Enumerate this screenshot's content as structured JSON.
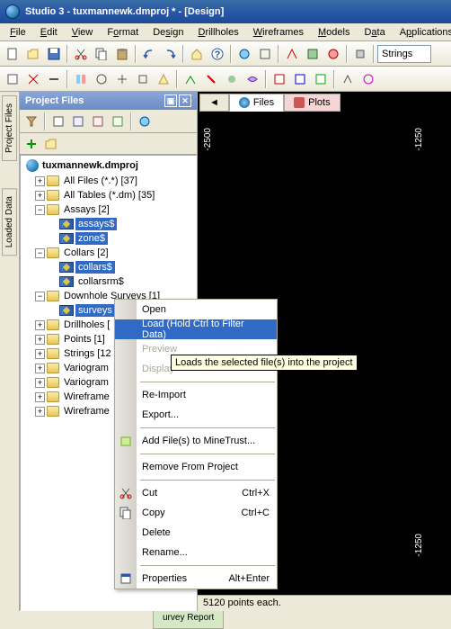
{
  "window": {
    "title": "Studio 3 - tuxmannewk.dmproj * - [Design]"
  },
  "menus": {
    "file": "File",
    "edit": "Edit",
    "view": "View",
    "format": "Format",
    "design": "Design",
    "drillholes": "Drillholes",
    "wireframes": "Wireframes",
    "models": "Models",
    "data": "Data",
    "applications": "Applications"
  },
  "toolbar2_input": {
    "value": "Strings"
  },
  "sidebar": {
    "tab1": "Project Files",
    "tab2": "Loaded Data"
  },
  "panel": {
    "title": "Project Files",
    "root": "tuxmannewk.dmproj",
    "items": {
      "all_files": "All Files (*.*) [37]",
      "all_tables": "All Tables (*.dm) [35]",
      "assays": "Assays [2]",
      "assays_item1": "assays$",
      "assays_item2": "zone$",
      "collars": "Collars [2]",
      "collars_item1": "collars$",
      "collars_item2": "collarsrm$",
      "surveys": "Downhole Surveys [1]",
      "surveys_item1": "surveys",
      "drillholes": "Drillholes [",
      "points": "Points [1]",
      "strings": "Strings [12",
      "variograms1": "Variogram",
      "variograms2": "Variogram",
      "wireframe1": "Wireframe",
      "wireframe2": "Wireframe"
    }
  },
  "viewport": {
    "tabs": {
      "files": "Files",
      "plots": "Plots"
    },
    "axis": {
      "top_left": "-2500",
      "top_right": "-1250",
      "bot_right": "-1250"
    }
  },
  "context_menu": {
    "open": "Open",
    "load": "Load  (Hold Ctrl to Filter Data)",
    "preview": "Preview",
    "display": "Display",
    "reimport": "Re-Import",
    "export": "Export...",
    "addfiles": "Add File(s) to MineTrust...",
    "remove": "Remove From Project",
    "cut": "Cut",
    "cut_sc": "Ctrl+X",
    "copy": "Copy",
    "copy_sc": "Ctrl+C",
    "delete": "Delete",
    "rename": "Rename...",
    "properties": "Properties",
    "properties_sc": "Alt+Enter"
  },
  "tooltip": "Loads the selected file(s) into the project",
  "status": "5120 points each.",
  "bottom_tab": "urvey Report"
}
